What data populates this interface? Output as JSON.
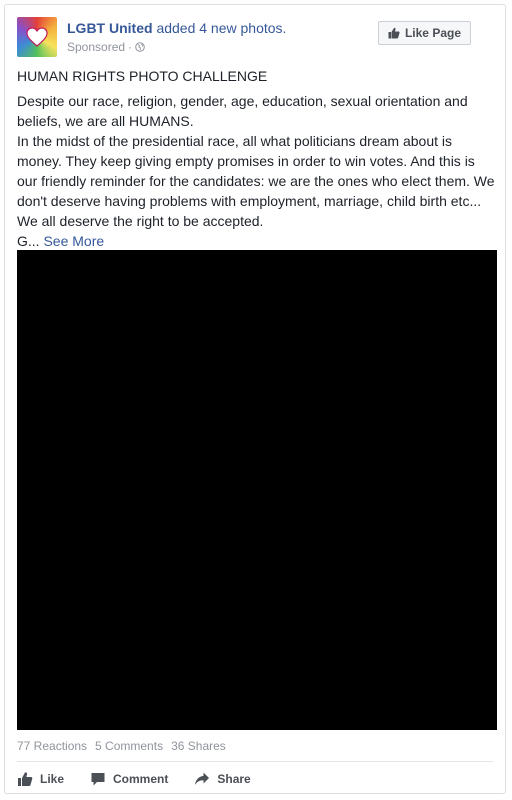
{
  "post": {
    "author": "LGBT United",
    "action": "added 4 new photos.",
    "sponsored": "Sponsored",
    "meta_separator": "·",
    "like_page_label": "Like Page",
    "title": "HUMAN RIGHTS PHOTO CHALLENGE",
    "body": "Despite our race, religion, gender, age, education, sexual orientation and beliefs, we are all HUMANS.\nIn the midst of the presidential race, all what politicians dream about is money. They keep giving empty promises in order to win votes. And this is our friendly reminder for the candidates: we are the ones who elect them. We don't deserve having problems with employment, marriage, child birth etc... We all deserve the right to be accepted.\nG... ",
    "see_more": "See More",
    "icons": [
      "globe-icon",
      "thumbs-up-icon",
      "comment-icon",
      "share-icon"
    ]
  },
  "stats": {
    "reactions": "77 Reactions",
    "comments": "5 Comments",
    "shares": "36 Shares"
  },
  "actions": {
    "like": "Like",
    "comment": "Comment",
    "share": "Share"
  },
  "colors": {
    "link": "#365899",
    "muted": "#90949c",
    "media_bg": "#000000"
  }
}
